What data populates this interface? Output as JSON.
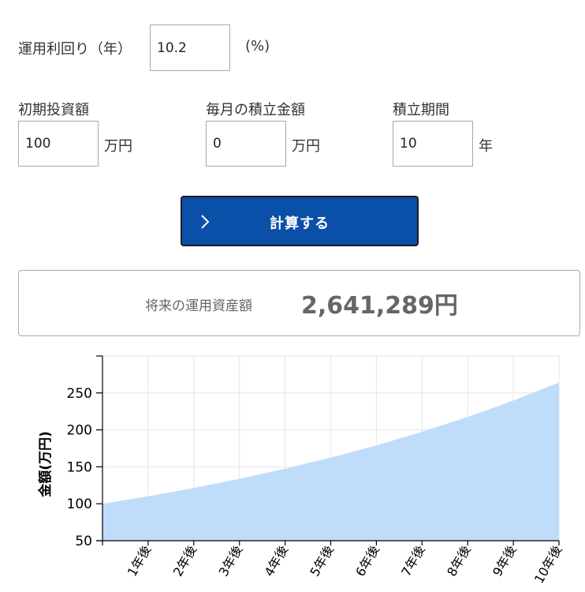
{
  "form": {
    "rate_label": "運用利回り（年）",
    "rate_value": "10.2",
    "rate_unit": "(%)",
    "initial_label": "初期投資額",
    "initial_value": "100",
    "initial_unit": "万円",
    "monthly_label": "毎月の積立金額",
    "monthly_value": "0",
    "monthly_unit": "万円",
    "period_label": "積立期間",
    "period_value": "10",
    "period_unit": "年",
    "calc_button": "計算する"
  },
  "result": {
    "label": "将来の運用資産額",
    "value": "2,641,289円"
  },
  "colors": {
    "button": "#0a4fa8",
    "area_fill": "#c0dcfb",
    "grid": "#e6e6e6"
  },
  "chart_data": {
    "type": "area",
    "ylabel": "金額(万円)",
    "categories": [
      "",
      "1年後",
      "2年後",
      "3年後",
      "4年後",
      "5年後",
      "6年後",
      "7年後",
      "8年後",
      "9年後",
      "10年後"
    ],
    "values": [
      100,
      110.2,
      121.4,
      133.8,
      147.5,
      162.5,
      179.1,
      197.4,
      217.5,
      239.7,
      264.1
    ],
    "ylim": [
      50,
      300
    ],
    "yticks": [
      50,
      100,
      150,
      200,
      250
    ],
    "grid": true,
    "legend": "none"
  }
}
